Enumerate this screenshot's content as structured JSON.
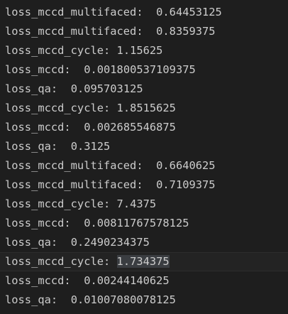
{
  "terminal": {
    "lines": [
      {
        "key": "loss_mccd_multifaced:",
        "value": "0.64453125",
        "sep": "  "
      },
      {
        "key": "loss_mccd_multifaced:",
        "value": "0.8359375",
        "sep": "  "
      },
      {
        "key": "loss_mccd_cycle:",
        "value": "1.15625",
        "sep": " "
      },
      {
        "key": "loss_mccd:",
        "value": "0.001800537109375",
        "sep": "  "
      },
      {
        "key": "loss_qa:",
        "value": "0.095703125",
        "sep": "  "
      },
      {
        "key": "loss_mccd_cycle:",
        "value": "1.8515625",
        "sep": " "
      },
      {
        "key": "loss_mccd:",
        "value": "0.002685546875",
        "sep": "  "
      },
      {
        "key": "loss_qa:",
        "value": "0.3125",
        "sep": "  "
      },
      {
        "key": "loss_mccd_multifaced:",
        "value": "0.6640625",
        "sep": "  "
      },
      {
        "key": "loss_mccd_multifaced:",
        "value": "0.7109375",
        "sep": "  "
      },
      {
        "key": "loss_mccd_cycle:",
        "value": "7.4375",
        "sep": " "
      },
      {
        "key": "loss_mccd:",
        "value": "0.00811767578125",
        "sep": "  "
      },
      {
        "key": "loss_qa:",
        "value": "0.2490234375",
        "sep": "  "
      },
      {
        "key": "loss_mccd_cycle:",
        "value": "1.734375",
        "sep": " ",
        "selected": true
      },
      {
        "key": "loss_mccd:",
        "value": "0.00244140625",
        "sep": "  "
      },
      {
        "key": "loss_qa:",
        "value": "0.01007080078125",
        "sep": "  "
      }
    ]
  },
  "colors": {
    "background": "#1e1e1e",
    "text": "#cccccc",
    "selection": "#3a3d41"
  }
}
